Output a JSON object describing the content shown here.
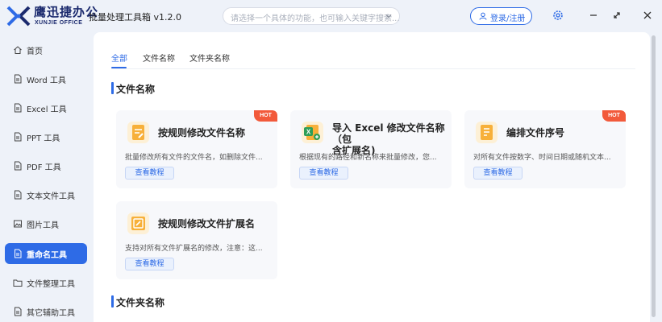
{
  "app": {
    "brand_cn": "迅捷办公",
    "brand_mark": "鹰",
    "brand_en": "XUNJIE OFFICE",
    "title": "批量处理工具箱 v1.2.0"
  },
  "search": {
    "placeholder": "请选择一个具体的功能，也可输入关键字搜索..."
  },
  "header": {
    "login_label": "登录/注册"
  },
  "sidebar": {
    "items": [
      {
        "label": "首页",
        "icon": "home-icon"
      },
      {
        "label": "Word 工具",
        "icon": "document-icon"
      },
      {
        "label": "Excel 工具",
        "icon": "document-icon"
      },
      {
        "label": "PPT 工具",
        "icon": "document-icon"
      },
      {
        "label": "PDF 工具",
        "icon": "document-icon"
      },
      {
        "label": "文本文件工具",
        "icon": "document-icon"
      },
      {
        "label": "图片工具",
        "icon": "image-icon"
      },
      {
        "label": "重命名工具",
        "icon": "rename-icon",
        "active": true
      },
      {
        "label": "文件整理工具",
        "icon": "folder-icon"
      },
      {
        "label": "其它辅助工具",
        "icon": "tools-icon"
      }
    ]
  },
  "tabs": [
    {
      "label": "全部",
      "active": true
    },
    {
      "label": "文件名称"
    },
    {
      "label": "文件夹名称"
    }
  ],
  "sections": {
    "file_name": {
      "title": "文件名称"
    },
    "folder_name": {
      "title": "文件夹名称"
    }
  },
  "cards": [
    {
      "title": "按规则修改文件名称",
      "desc": "批量修改所有文件的文件名，如删除文件...",
      "button": "查看教程",
      "badge": "HOT",
      "icon": "edit-doc-icon"
    },
    {
      "title": "导入 Excel 修改文件名称（包含扩展名)",
      "title_line1": "导入 Excel 修改文件名称（包",
      "title_line2": "含扩展名)",
      "desc": "根据现有的路径和新名称来批量修改，您...",
      "button": "查看教程",
      "icon": "excel-icon"
    },
    {
      "title": "编排文件序号",
      "desc": "对所有文件按数字、时间日期或随机文本...",
      "button": "查看教程",
      "badge": "HOT",
      "icon": "sort-doc-icon"
    },
    {
      "title": "按规则修改文件扩展名",
      "desc": "支持对所有文件扩展名的修改，注意：这...",
      "button": "查看教程",
      "icon": "ext-doc-icon"
    }
  ],
  "colors": {
    "accent": "#2e6be6",
    "hot": "#f25a3b",
    "icon_orange": "#f7b03a",
    "excel_green": "#2f9e57"
  }
}
